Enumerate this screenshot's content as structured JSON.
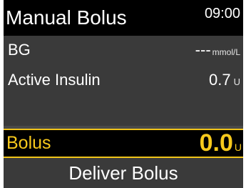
{
  "header": {
    "title": "Manual Bolus",
    "time": "09:00"
  },
  "info": {
    "bg": {
      "label": "BG",
      "value": "---",
      "unit": "mmol/L"
    },
    "active_insulin": {
      "label": "Active Insulin",
      "value": "0.7",
      "unit": "U"
    }
  },
  "bolus": {
    "label": "Bolus",
    "value": "0.0",
    "unit": "U"
  },
  "deliver_button": {
    "label": "Deliver Bolus"
  },
  "colors": {
    "accent": "#f7c91c",
    "background": "#000000",
    "panel": "#3a3a3a"
  }
}
